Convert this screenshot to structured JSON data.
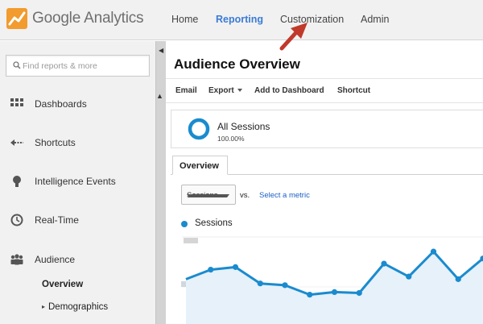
{
  "header": {
    "logo_text": "Google Analytics",
    "nav": [
      {
        "label": "Home",
        "active": false
      },
      {
        "label": "Reporting",
        "active": true
      },
      {
        "label": "Customization",
        "active": false
      },
      {
        "label": "Admin",
        "active": false
      }
    ]
  },
  "sidebar": {
    "search_placeholder": "Find reports & more",
    "items": [
      {
        "label": "Dashboards",
        "icon": "grid-icon"
      },
      {
        "label": "Shortcuts",
        "icon": "shortcut-arrow-icon"
      },
      {
        "label": "Intelligence Events",
        "icon": "lightbulb-icon"
      },
      {
        "label": "Real-Time",
        "icon": "clock-icon"
      },
      {
        "label": "Audience",
        "icon": "people-icon"
      }
    ],
    "sub_items": [
      {
        "label": "Overview",
        "selected": true
      },
      {
        "label": "Demographics",
        "expandable": true
      }
    ]
  },
  "main": {
    "title": "Audience Overview",
    "toolbar": {
      "email": "Email",
      "export": "Export",
      "add_to_dashboard": "Add to Dashboard",
      "shortcut": "Shortcut"
    },
    "segment": {
      "name": "All Sessions",
      "percent": "100.00%"
    },
    "tab": "Overview",
    "metric_select": "Sessions",
    "vs": "vs.",
    "select_metric": "Select a metric",
    "legend": "Sessions"
  },
  "colors": {
    "accent_blue": "#3a7bd5",
    "series_blue": "#1a8bce",
    "area_fill": "#e6f1f9",
    "annotation_red": "#c0392b"
  },
  "chart_data": {
    "type": "line",
    "series": [
      {
        "name": "Sessions",
        "values": [
          0.52,
          0.63,
          0.66,
          0.47,
          0.45,
          0.34,
          0.37,
          0.36,
          0.7,
          0.55,
          0.84,
          0.52,
          0.76
        ]
      }
    ],
    "ylim": [
      0,
      1
    ],
    "grid": true
  }
}
